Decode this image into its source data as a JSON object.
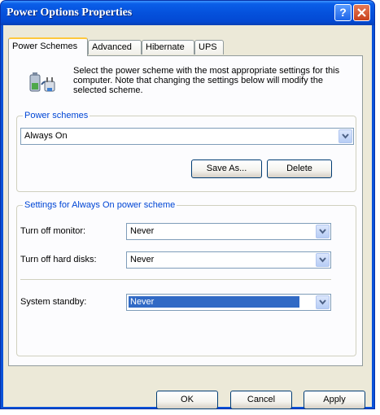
{
  "window": {
    "title": "Power Options Properties",
    "help_glyph": "?"
  },
  "tabs": [
    {
      "label": "Power Schemes",
      "active": true
    },
    {
      "label": "Advanced",
      "active": false
    },
    {
      "label": "Hibernate",
      "active": false
    },
    {
      "label": "UPS",
      "active": false
    }
  ],
  "intro": {
    "text": "Select the power scheme with the most appropriate settings for this computer. Note that changing the settings below will modify the selected scheme.",
    "icon": "battery-plug-icon"
  },
  "power_schemes": {
    "group_label": "Power schemes",
    "selected": "Always On",
    "save_as_label": "Save As...",
    "delete_label": "Delete"
  },
  "settings": {
    "group_label": "Settings for Always On power scheme",
    "monitor_label": "Turn off monitor:",
    "monitor_value": "Never",
    "hard_disks_label": "Turn off hard disks:",
    "hard_disks_value": "Never",
    "standby_label": "System standby:",
    "standby_value": "Never"
  },
  "footer": {
    "ok_label": "OK",
    "cancel_label": "Cancel",
    "apply_label": "Apply"
  },
  "colors": {
    "title_bar": "#0551dc",
    "dialog_face": "#ece9d8",
    "group_label": "#0046d5",
    "selection": "#316ac5"
  }
}
